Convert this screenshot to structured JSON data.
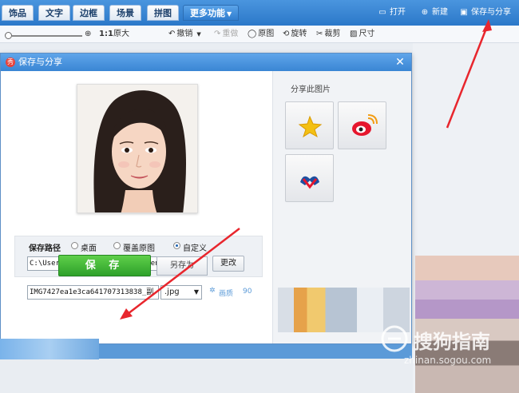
{
  "top_tabs": [
    "饰品",
    "文字",
    "边框",
    "场景",
    "拼图",
    "更多功能"
  ],
  "top_actions": {
    "open": "打开",
    "new": "新建",
    "save_share": "保存与分享"
  },
  "toolbar": {
    "ratio": "1:1",
    "original_size": "原大",
    "undo": "撤销",
    "redo": "重做",
    "original_image": "原图",
    "rotate": "旋转",
    "crop": "裁剪",
    "size": "尺寸"
  },
  "dialog": {
    "title": "保存与分享",
    "share_label": "分享此图片",
    "save_path_label": "保存路径",
    "options": [
      "桌面",
      "覆盖原图",
      "自定义"
    ],
    "selected_option": "自定义",
    "path_value": "C:\\Users\\Administrator\\Documents\\美图图库",
    "change_button": "更改",
    "filename_value": "IMG7427ea1e3ca641707313838_副",
    "format_value": ".jpg",
    "quality_label": "画质",
    "quality_value": "90",
    "save_button": "保 存",
    "save_as_button": "另存为"
  },
  "watermark": {
    "brand": "搜狗指南",
    "url": "zhinan.sogou.com"
  },
  "colors": {
    "accent": "#2b78c9",
    "save_green": "#2ea12a",
    "arrow_red": "#e8262d"
  }
}
